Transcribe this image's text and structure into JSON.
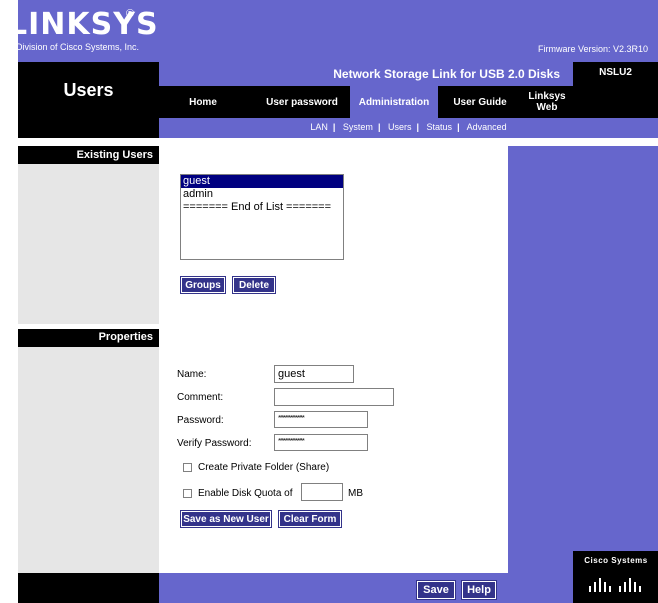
{
  "header": {
    "logo": "LINKSYS",
    "logo_mark": "®",
    "logo_sub": "A Division of Cisco Systems, Inc.",
    "firmware": "Firmware Version:  V2.3R10"
  },
  "page_title": "Users",
  "product": "Network Storage Link for USB 2.0 Disks",
  "model": "NSLU2",
  "tabs": [
    {
      "label": "Home"
    },
    {
      "label": "User password"
    },
    {
      "label": "Administration"
    },
    {
      "label": "User Guide"
    },
    {
      "label": "Linksys Web"
    }
  ],
  "subnav": [
    "LAN",
    "System",
    "Users",
    "Status",
    "Advanced"
  ],
  "sections": {
    "existing_users": "Existing Users",
    "properties": "Properties"
  },
  "user_list": [
    "guest",
    "admin",
    "======= End of List ======="
  ],
  "buttons": {
    "groups": "Groups",
    "delete": "Delete",
    "save_as_new": "Save as New User",
    "clear_form": "Clear Form",
    "save": "Save",
    "help": "Help"
  },
  "form": {
    "name_label": "Name:",
    "name_value": "guest",
    "comment_label": "Comment:",
    "comment_value": "",
    "password_label": "Password:",
    "password_value": "***************",
    "verify_label": "Verify Password:",
    "verify_value": "***************",
    "private_folder": "Create Private Folder (Share)",
    "disk_quota": "Enable Disk Quota of",
    "quota_value": "",
    "quota_unit": "MB"
  },
  "footer": {
    "cisco": "Cisco Systems"
  }
}
